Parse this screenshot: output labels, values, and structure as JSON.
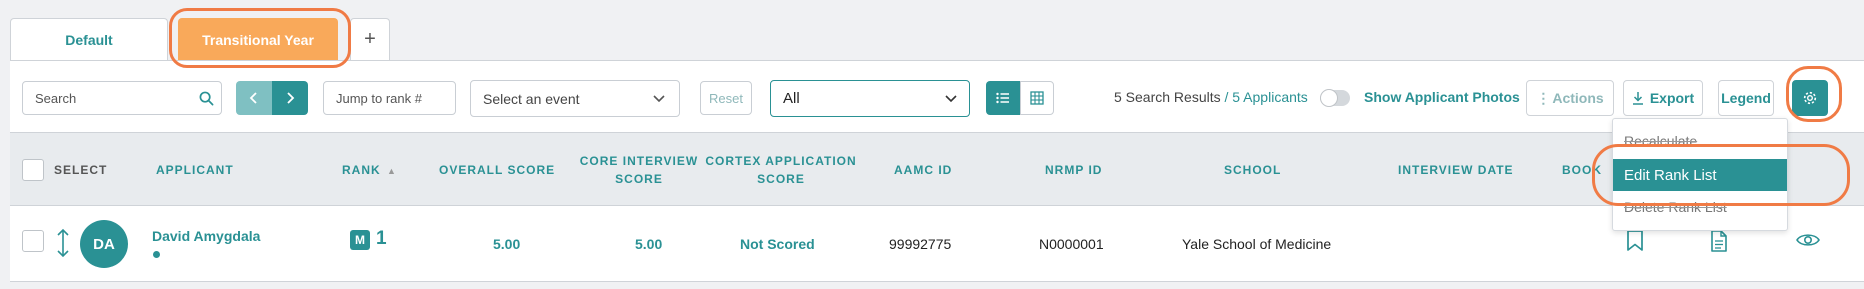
{
  "tabs": [
    {
      "label": "Default"
    },
    {
      "label": "Transitional Year"
    },
    {
      "label": "+"
    }
  ],
  "toolbar": {
    "search_placeholder": "Search",
    "jump_placeholder": "Jump to rank #",
    "event_select": "Select an event",
    "reset_label": "Reset",
    "filter_value": "All",
    "results_text": "5 Search Results",
    "applicants_text": " / 5 Applicants",
    "show_photos_label": "Show Applicant Photos",
    "actions_label": "Actions",
    "export_label": "Export",
    "legend_label": "Legend"
  },
  "table": {
    "headers": {
      "select": "SELECT",
      "applicant": "APPLICANT",
      "rank": "RANK",
      "overall": "OVERALL SCORE",
      "core_1": "CORE INTERVIEW",
      "core_2": "SCORE",
      "cortex_1": "CORTEX APPLICATION",
      "cortex_2": "SCORE",
      "aamc": "AAMC ID",
      "nrmp": "NRMP ID",
      "school": "SCHOOL",
      "interview_date": "INTERVIEW DATE",
      "book": "BOOK"
    },
    "rows": [
      {
        "initials": "DA",
        "name": "David Amygdala",
        "rank_badge": "M",
        "rank": "1",
        "overall": "5.00",
        "core": "5.00",
        "cortex": "Not Scored",
        "aamc": "99992775",
        "nrmp": "N0000001",
        "school": "Yale School of Medicine",
        "interview_date": ""
      }
    ]
  },
  "settings_menu": {
    "items": [
      {
        "label": "Recalculate"
      },
      {
        "label": "Edit Rank List"
      },
      {
        "label": "Delete Rank List"
      }
    ]
  },
  "colors": {
    "accent": "#2a9194",
    "active_tab": "#f9a95a",
    "highlight_ring": "#f07b45"
  }
}
